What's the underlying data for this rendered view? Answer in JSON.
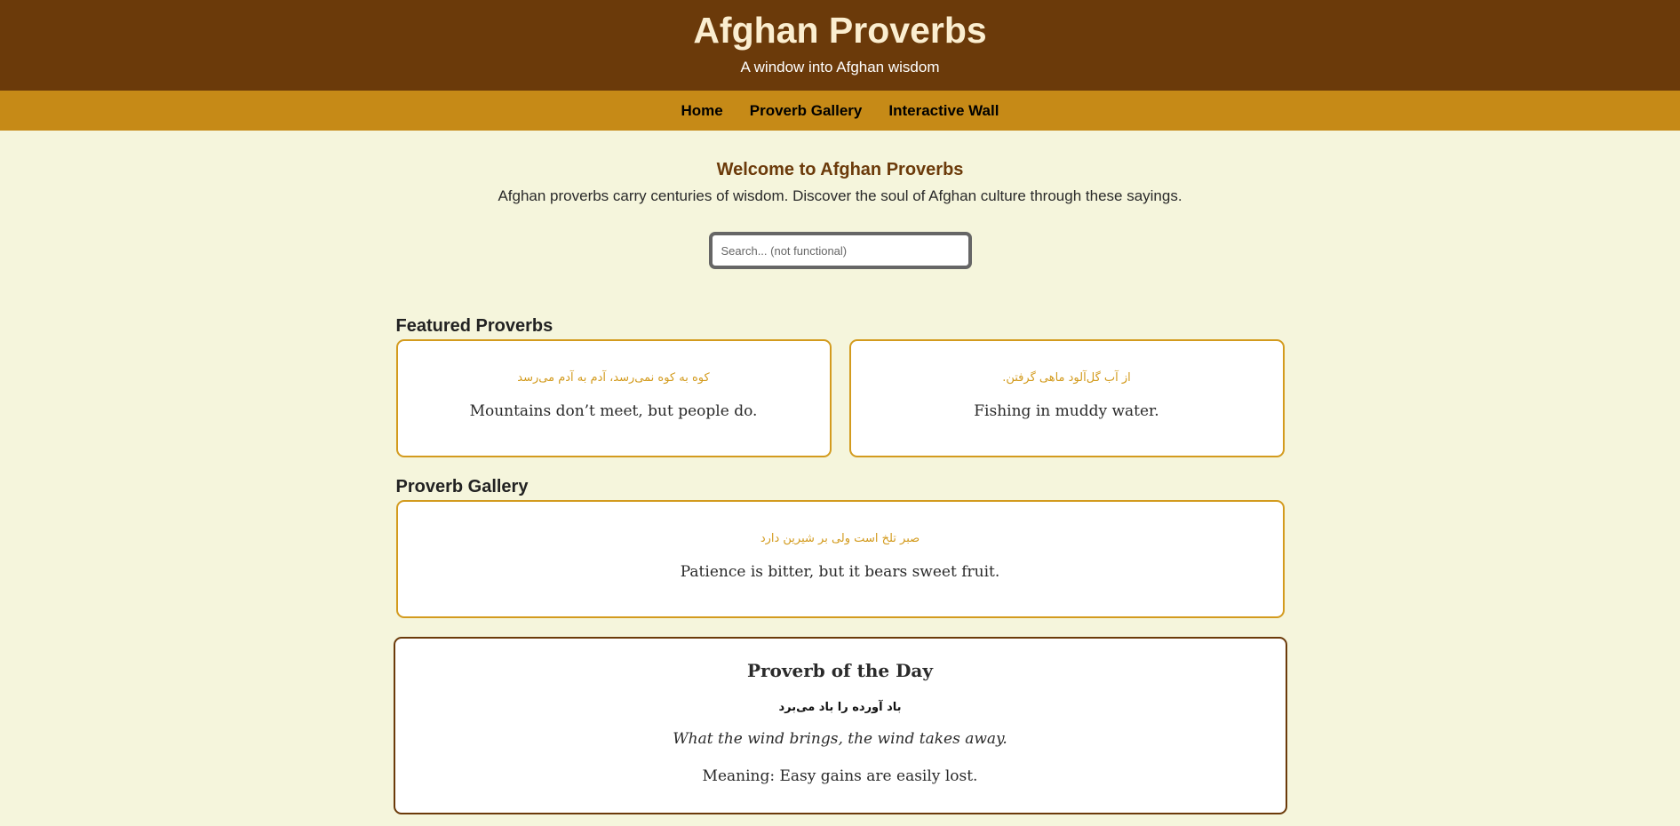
{
  "header": {
    "title": "Afghan Proverbs",
    "subtitle": "A window into Afghan wisdom"
  },
  "nav": {
    "items": [
      {
        "label": "Home"
      },
      {
        "label": "Proverb Gallery"
      },
      {
        "label": "Interactive Wall"
      }
    ]
  },
  "intro": {
    "heading": "Welcome to Afghan Proverbs",
    "text": "Afghan proverbs carry centuries of wisdom. Discover the soul of Afghan culture through these sayings."
  },
  "search": {
    "placeholder": "Search... (not functional)",
    "value": ""
  },
  "featured": {
    "heading": "Featured Proverbs",
    "cards": [
      {
        "original": "کوه به کوه نمی‌رسد، آدم به آدم می‌رسد",
        "translation": "Mountains don’t meet, but people do."
      },
      {
        "original": "از آب گل‌آلود ماهی گرفتن.",
        "translation": "Fishing in muddy water."
      }
    ]
  },
  "gallery": {
    "heading": "Proverb Gallery",
    "cards": [
      {
        "original": "صبر تلخ است ولی بر شیرین دارد",
        "translation": "Patience is bitter, but it bears sweet fruit."
      }
    ]
  },
  "proverb_of_the_day": {
    "title": "Proverb of the Day",
    "original": "باد آورده را باد می‌برد",
    "translation": "What the wind brings, the wind takes away.",
    "meaning": "Meaning: Easy gains are easily lost."
  },
  "colors": {
    "header_bg": "#6b3a0a",
    "nav_bg": "#c68a17",
    "page_bg": "#f5f5dc",
    "card_border": "#d39b1e",
    "potd_border": "#6b3a0a"
  }
}
